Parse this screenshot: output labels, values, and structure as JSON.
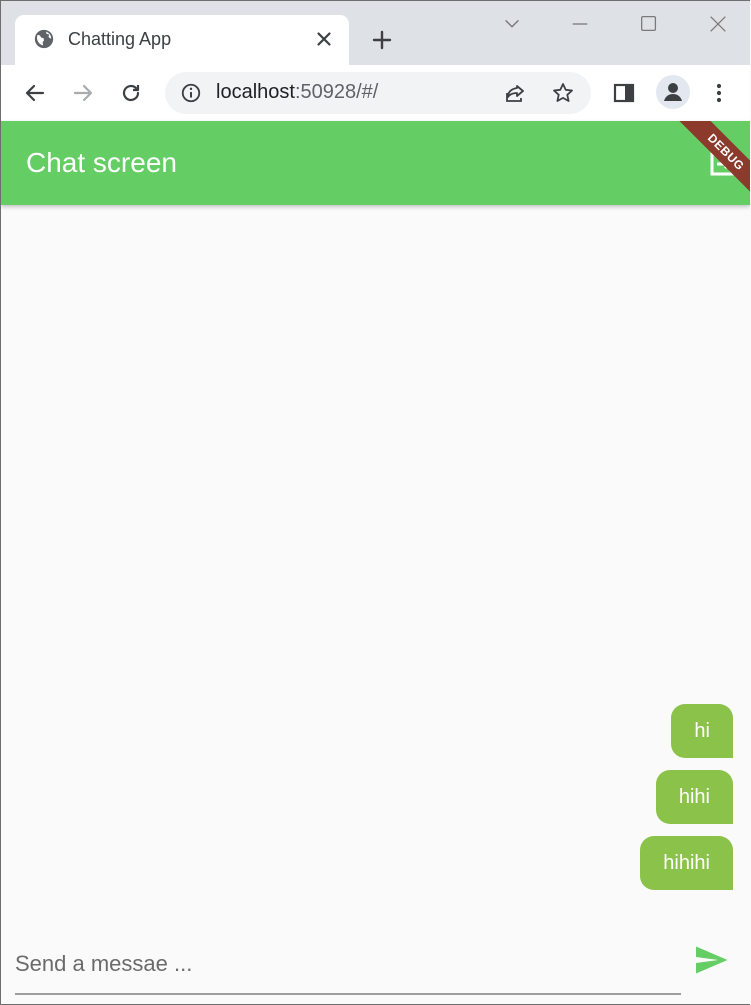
{
  "browser": {
    "tab_title": "Chatting App",
    "url_host": "localhost",
    "url_rest": ":50928/#/"
  },
  "appbar": {
    "title": "Chat screen",
    "debug_label": "DEBUG",
    "color": "#64cd64"
  },
  "messages": [
    {
      "text": "hi",
      "sender": "me"
    },
    {
      "text": "hihi",
      "sender": "me"
    },
    {
      "text": "hihihi",
      "sender": "me"
    }
  ],
  "composer": {
    "placeholder": "Send a messae ..."
  },
  "colors": {
    "bubble": "#8bc34a",
    "send_icon": "#64cd64",
    "debug_banner": "#8b3a2b"
  }
}
